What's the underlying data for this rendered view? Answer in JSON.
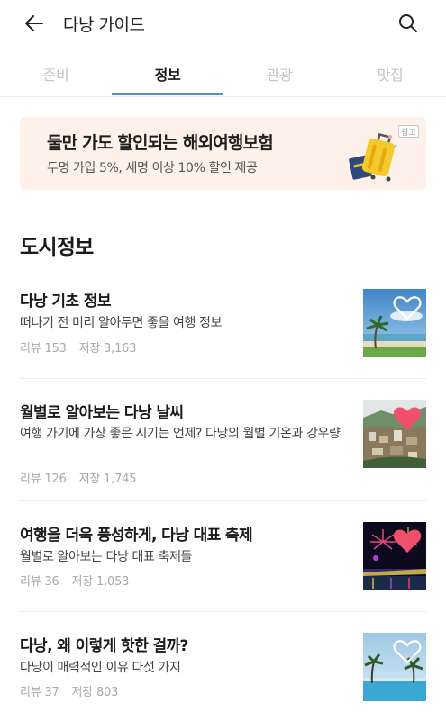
{
  "header": {
    "title": "다낭 가이드",
    "back_icon": "arrow-left-icon",
    "search_icon": "search-icon"
  },
  "tabs": [
    {
      "label": "준비",
      "active": false
    },
    {
      "label": "정보",
      "active": true
    },
    {
      "label": "관광",
      "active": false
    },
    {
      "label": "맛집",
      "active": false
    }
  ],
  "ad": {
    "title": "둘만 가도 할인되는 해외여행보험",
    "subtitle": "두명 가입 5%, 세명 이상 10% 할인 제공",
    "badge": "광고",
    "background": "#fdf1ea"
  },
  "section": {
    "title": "도시정보"
  },
  "items": [
    {
      "title": "다낭 기초 정보",
      "desc": "떠나기 전 미리 알아두면 좋을 여행 정보",
      "reviews": "리뷰 153",
      "saves": "저장 3,163",
      "saved": false
    },
    {
      "title": "월별로 알아보는 다낭 날씨",
      "desc": "여행 가기에 가장 좋은 시기는 언제? 다낭의 월별 기온과 강우량",
      "reviews": "리뷰 126",
      "saves": "저장 1,745",
      "saved": true
    },
    {
      "title": "여행을 더욱 풍성하게, 다낭 대표 축제",
      "desc": "월별로 알아보는 다낭 대표 축제들",
      "reviews": "리뷰 36",
      "saves": "저장 1,053",
      "saved": true
    },
    {
      "title": "다낭, 왜 이렇게 핫한 걸까?",
      "desc": "다낭이 매력적인 이유 다섯 가지",
      "reviews": "리뷰 37",
      "saves": "저장 803",
      "saved": false
    }
  ],
  "colors": {
    "accent": "#4a8fd9",
    "heart_saved": "#f0506e"
  }
}
